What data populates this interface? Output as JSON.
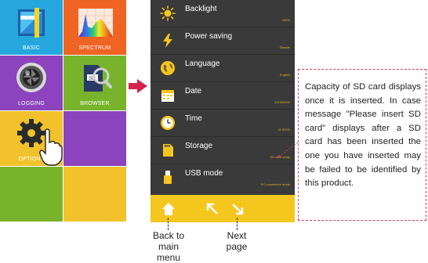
{
  "menu_tiles": [
    {
      "label": "BASIC"
    },
    {
      "label": "SPECTRUM"
    },
    {
      "label": "LOGGING"
    },
    {
      "label": "BROWSER"
    },
    {
      "label": "OPTIONS"
    }
  ],
  "settings": [
    {
      "name": "Backlight",
      "value": "100%",
      "icon": "sun-icon"
    },
    {
      "name": "Power saving",
      "value": "Disable",
      "icon": "lightning-icon"
    },
    {
      "name": "Language",
      "value": "English",
      "icon": "globe-icon"
    },
    {
      "name": "Date",
      "value": "2019/00/00",
      "icon": "calendar-icon"
    },
    {
      "name": "Time",
      "value": "11:00:00",
      "icon": "clock-icon"
    },
    {
      "name": "Storage",
      "value": "SD card ready",
      "icon": "sd-card-icon"
    },
    {
      "name": "USB mode",
      "value": "PC connection mode",
      "icon": "usb-icon"
    }
  ],
  "bottom_bar": {
    "home_icon": "home-icon",
    "prev_icon": "page-up-icon",
    "next_icon": "page-down-icon"
  },
  "captions": {
    "home": "Back to main menu",
    "next": "Next page"
  },
  "callout": {
    "text": "Capacity of SD card displays once it is inserted. In case message \"Please insert SD card\" displays after a SD card has been inserted the one you have inserted may be failed to be identified by this product."
  },
  "colors": {
    "blue": "#25a7de",
    "orange": "#ef6423",
    "purple": "#8b44bd",
    "green": "#77b42c",
    "yellow": "#f1c22c",
    "screen": "#3a3a3a",
    "accent_red": "#d23a55"
  }
}
